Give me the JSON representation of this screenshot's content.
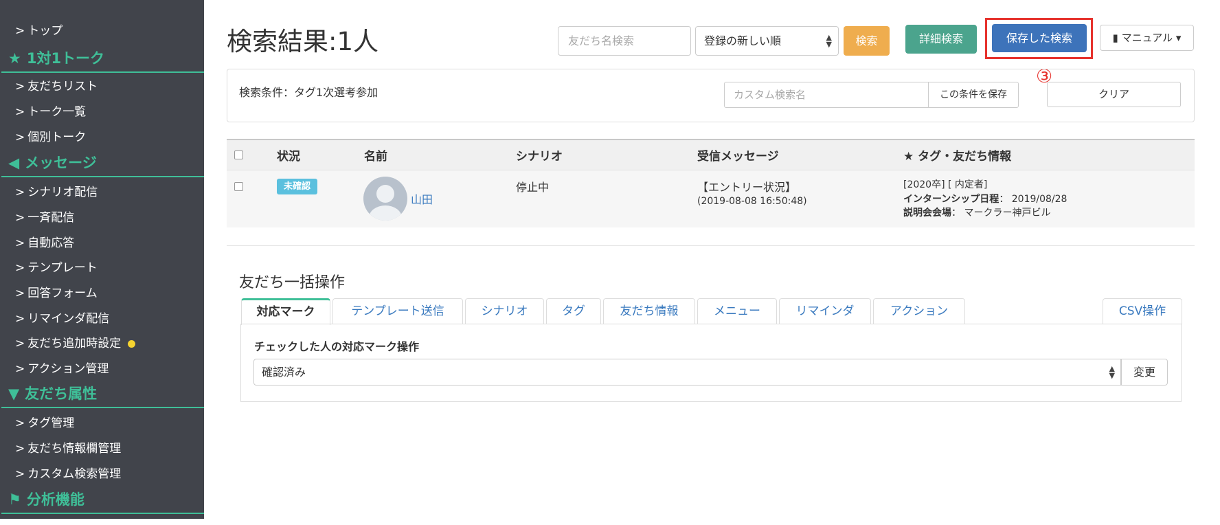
{
  "sidebar": {
    "top": "トップ",
    "head_talk": "1対1トーク",
    "friend_list": "友だちリスト",
    "talk_list": "トーク一覧",
    "individual_talk": "個別トーク",
    "head_message": "メッセージ",
    "scenario_delivery": "シナリオ配信",
    "broadcast": "一斉配信",
    "auto_reply": "自動応答",
    "template": "テンプレート",
    "answer_form": "回答フォーム",
    "reminder_delivery": "リマインダ配信",
    "friend_add_settings": "友だち追加時設定",
    "action_management": "アクション管理",
    "head_attributes": "友だち属性",
    "tag_management": "タグ管理",
    "friend_info_management": "友だち情報欄管理",
    "custom_search_management": "カスタム検索管理",
    "head_analysis": "分析機能"
  },
  "header": {
    "title": "検索結果:1人",
    "search_placeholder": "友だち名検索",
    "sort_selected": "登録の新しい順",
    "search_button": "検索",
    "detail_search_button": "詳細検索",
    "saved_search_button": "保存した検索",
    "manual_button": "マニュアル",
    "annotation_number": "③",
    "highlight_color": "#e6322d"
  },
  "conditions": {
    "text": "検索条件：タグ1次選考参加",
    "custom_name_placeholder": "カスタム検索名",
    "save_condition_button": "この条件を保存",
    "clear_button": "クリア"
  },
  "table": {
    "headers": {
      "status": "状況",
      "name": "名前",
      "scenario": "シナリオ",
      "received": "受信メッセージ",
      "tags": "★ タグ・友だち情報"
    },
    "rows": [
      {
        "status": "未確認",
        "name": "山田",
        "scenario": "停止中",
        "message": "【エントリー状況】",
        "message_time": "(2019-08-08 16:50:48)",
        "tags_line": "[2020卒] [ 内定者]",
        "info1_label": "インターンシップ日程",
        "info1_value": "： 2019/08/28",
        "info2_label": "説明会会場",
        "info2_value": "： マークラー神戸ビル"
      }
    ]
  },
  "bulk": {
    "title": "友だち一括操作",
    "tabs": [
      "対応マーク",
      "テンプレート送信",
      "シナリオ",
      "タグ",
      "友だち情報",
      "メニュー",
      "リマインダ",
      "アクション",
      "CSV操作"
    ],
    "panel_label": "チェックした人の対応マーク操作",
    "mark_selected": "確認済み",
    "change_button": "変更"
  },
  "colors": {
    "sidebar_bg": "#41444b",
    "sidebar_accent": "#3fbf98",
    "primary": "#3d73ba",
    "warning": "#efad4e",
    "success": "#4ba48d",
    "info": "#5bc0de"
  }
}
